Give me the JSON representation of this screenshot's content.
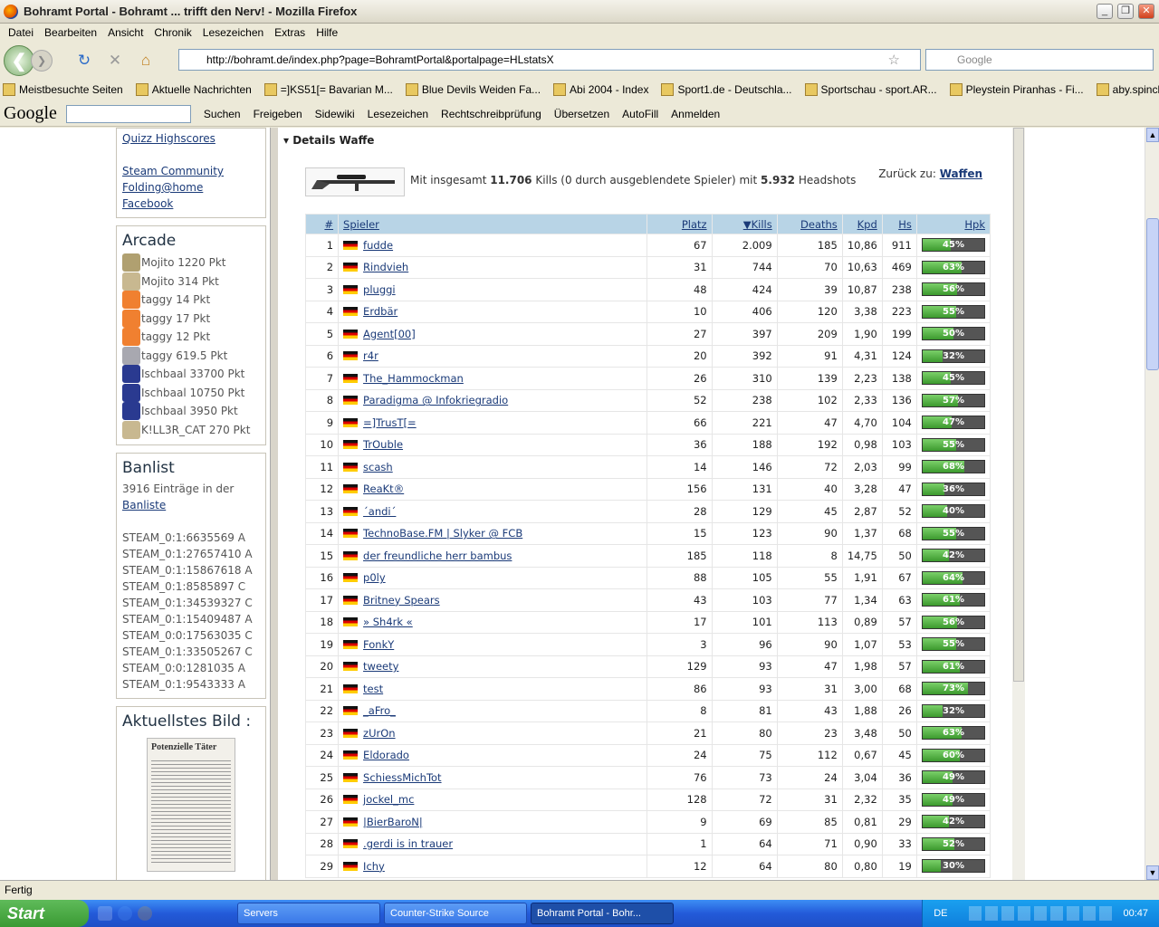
{
  "window": {
    "title": "Bohramt Portal - Bohramt ... trifft den Nerv! - Mozilla Firefox"
  },
  "menu": [
    "Datei",
    "Bearbeiten",
    "Ansicht",
    "Chronik",
    "Lesezeichen",
    "Extras",
    "Hilfe"
  ],
  "url": "http://bohramt.de/index.php?page=BohramtPortal&portalpage=HLstatsX",
  "search_placeholder": "Google",
  "bookmarks": [
    "Meistbesuchte Seiten",
    "Aktuelle Nachrichten",
    "=]KS51[= Bavarian M...",
    "Blue Devils Weiden Fa...",
    "Abi 2004 - Index",
    "Sport1.de - Deutschla...",
    "Sportschau - sport.AR...",
    "Pleystein Piranhas - Fi...",
    "aby.spinchat.de"
  ],
  "googlebar": {
    "logo": "Google",
    "items": [
      "Suchen",
      "Freigeben",
      "Sidewiki",
      "Lesezeichen",
      "Rechtschreibprüfung",
      "Übersetzen",
      "AutoFill",
      "Anmelden"
    ]
  },
  "links": [
    "Quizz Highscores",
    "Steam Community",
    "Folding@home",
    "Facebook"
  ],
  "arcade": {
    "title": "Arcade",
    "entries": [
      {
        "text": "Mojito 1220 Pkt",
        "color": "#b0a070"
      },
      {
        "text": "Mojito 314 Pkt",
        "color": "#c8b890"
      },
      {
        "text": "taggy 14 Pkt",
        "color": "#f08030"
      },
      {
        "text": "taggy 17 Pkt",
        "color": "#f08030"
      },
      {
        "text": "taggy 12 Pkt",
        "color": "#f08030"
      },
      {
        "text": "taggy 619.5 Pkt",
        "color": "#a8a8b0"
      },
      {
        "text": "Ischbaal 33700 Pkt",
        "color": "#2a3a90"
      },
      {
        "text": "Ischbaal 10750 Pkt",
        "color": "#2a3a90"
      },
      {
        "text": "Ischbaal 3950 Pkt",
        "color": "#2a3a90"
      },
      {
        "text": "K!LL3R_CAT 270 Pkt",
        "color": "#c8b890"
      }
    ]
  },
  "banlist": {
    "title": "Banlist",
    "count_text": "3916 Einträge in der",
    "link": "Banliste",
    "entries": [
      "STEAM_0:1:6635569 A",
      "STEAM_0:1:27657410 A",
      "STEAM_0:1:15867618 A",
      "STEAM_0:1:8585897 C",
      "STEAM_0:1:34539327 C",
      "STEAM_0:1:15409487 A",
      "STEAM_0:0:17563035 C",
      "STEAM_0:1:33505267 C",
      "STEAM_0:0:1281035 A",
      "STEAM_0:1:9543333 A"
    ]
  },
  "picture": {
    "title": "Aktuellstes Bild :",
    "caption": "Potenzielle Täter"
  },
  "details": {
    "section": "Details Waffe",
    "summary_pre": "Mit insgesamt ",
    "kills": "11.706",
    "summary_mid": " Kills (0 durch ausgeblendete Spieler) mit ",
    "headshots": "5.932",
    "summary_post": " Headshots",
    "back_label": "Zurück zu: ",
    "back_link": "Waffen"
  },
  "table": {
    "headers": [
      "#",
      "Spieler",
      "Platz",
      "▼Kills",
      "Deaths",
      "Kpd",
      "Hs",
      "Hpk"
    ],
    "rows": [
      [
        "1",
        "fudde",
        "67",
        "2.009",
        "185",
        "10,86",
        "911",
        45
      ],
      [
        "2",
        "Rindvieh",
        "31",
        "744",
        "70",
        "10,63",
        "469",
        63
      ],
      [
        "3",
        "pluggi",
        "48",
        "424",
        "39",
        "10,87",
        "238",
        56
      ],
      [
        "4",
        "Erdbär",
        "10",
        "406",
        "120",
        "3,38",
        "223",
        55
      ],
      [
        "5",
        "Agent[00]",
        "27",
        "397",
        "209",
        "1,90",
        "199",
        50
      ],
      [
        "6",
        "r4r",
        "20",
        "392",
        "91",
        "4,31",
        "124",
        32
      ],
      [
        "7",
        "The_Hammockman",
        "26",
        "310",
        "139",
        "2,23",
        "138",
        45
      ],
      [
        "8",
        "Paradigma @ Infokriegradio",
        "52",
        "238",
        "102",
        "2,33",
        "136",
        57
      ],
      [
        "9",
        "=]TrusT[=",
        "66",
        "221",
        "47",
        "4,70",
        "104",
        47
      ],
      [
        "10",
        "TrOuble",
        "36",
        "188",
        "192",
        "0,98",
        "103",
        55
      ],
      [
        "11",
        "scash",
        "14",
        "146",
        "72",
        "2,03",
        "99",
        68
      ],
      [
        "12",
        "ReaKt®",
        "156",
        "131",
        "40",
        "3,28",
        "47",
        36
      ],
      [
        "13",
        "´andi´",
        "28",
        "129",
        "45",
        "2,87",
        "52",
        40
      ],
      [
        "14",
        "TechnoBase.FM | Slyker @ FCB",
        "15",
        "123",
        "90",
        "1,37",
        "68",
        55
      ],
      [
        "15",
        "der freundliche herr bambus",
        "185",
        "118",
        "8",
        "14,75",
        "50",
        42
      ],
      [
        "16",
        "p0ly",
        "88",
        "105",
        "55",
        "1,91",
        "67",
        64
      ],
      [
        "17",
        "Britney Spears",
        "43",
        "103",
        "77",
        "1,34",
        "63",
        61
      ],
      [
        "18",
        "» Sh4rk «",
        "17",
        "101",
        "113",
        "0,89",
        "57",
        56
      ],
      [
        "19",
        "FonkY",
        "3",
        "96",
        "90",
        "1,07",
        "53",
        55
      ],
      [
        "20",
        "tweety",
        "129",
        "93",
        "47",
        "1,98",
        "57",
        61
      ],
      [
        "21",
        "test",
        "86",
        "93",
        "31",
        "3,00",
        "68",
        73
      ],
      [
        "22",
        "_aFro_",
        "8",
        "81",
        "43",
        "1,88",
        "26",
        32
      ],
      [
        "23",
        "zUrOn",
        "21",
        "80",
        "23",
        "3,48",
        "50",
        63
      ],
      [
        "24",
        "Eldorado",
        "24",
        "75",
        "112",
        "0,67",
        "45",
        60
      ],
      [
        "25",
        "SchiessMichTot",
        "76",
        "73",
        "24",
        "3,04",
        "36",
        49
      ],
      [
        "26",
        "jockel_mc",
        "128",
        "72",
        "31",
        "2,32",
        "35",
        49
      ],
      [
        "27",
        "|BierBaroN|",
        "9",
        "69",
        "85",
        "0,81",
        "29",
        42
      ],
      [
        "28",
        ".gerdi is in trauer",
        "1",
        "64",
        "71",
        "0,90",
        "33",
        52
      ],
      [
        "29",
        "Ichy",
        "12",
        "64",
        "80",
        "0,80",
        "19",
        30
      ]
    ]
  },
  "status": "Fertig",
  "taskbar": {
    "start": "Start",
    "tasks": [
      "Servers",
      "Counter-Strike Source",
      "Bohramt Portal - Bohr..."
    ],
    "lang": "DE",
    "clock": "00:47"
  }
}
